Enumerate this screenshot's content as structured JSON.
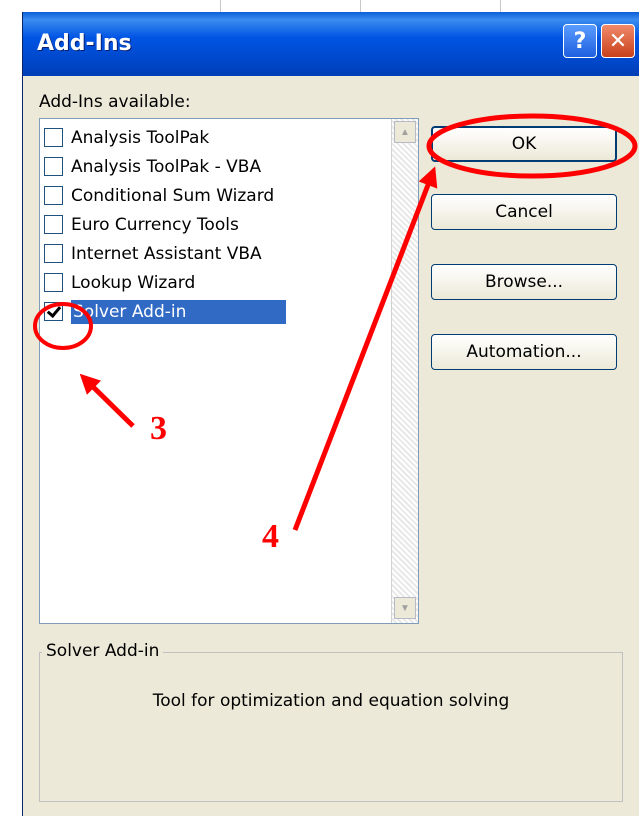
{
  "dialog": {
    "title": "Add-Ins"
  },
  "titlebar": {
    "help_glyph": "?",
    "close_glyph": "✕"
  },
  "addins_label": "Add-Ins available:",
  "items": [
    {
      "label": "Analysis ToolPak",
      "checked": false
    },
    {
      "label": "Analysis ToolPak - VBA",
      "checked": false
    },
    {
      "label": "Conditional Sum Wizard",
      "checked": false
    },
    {
      "label": "Euro Currency Tools",
      "checked": false
    },
    {
      "label": "Internet Assistant VBA",
      "checked": false
    },
    {
      "label": "Lookup Wizard",
      "checked": false
    },
    {
      "label": "Solver Add-in",
      "checked": true,
      "selected": true
    }
  ],
  "buttons": {
    "ok": "OK",
    "cancel": "Cancel",
    "browse": "Browse...",
    "automation": "Automation..."
  },
  "description": {
    "title": "Solver Add-in",
    "text": "Tool for optimization and equation solving"
  },
  "annotations": {
    "step3": "3",
    "step4": "4"
  },
  "colors": {
    "annotation": "#ff0000",
    "selection": "#316ac5",
    "titlebar": "#0054e3",
    "dialog_bg": "#ece9d8"
  }
}
